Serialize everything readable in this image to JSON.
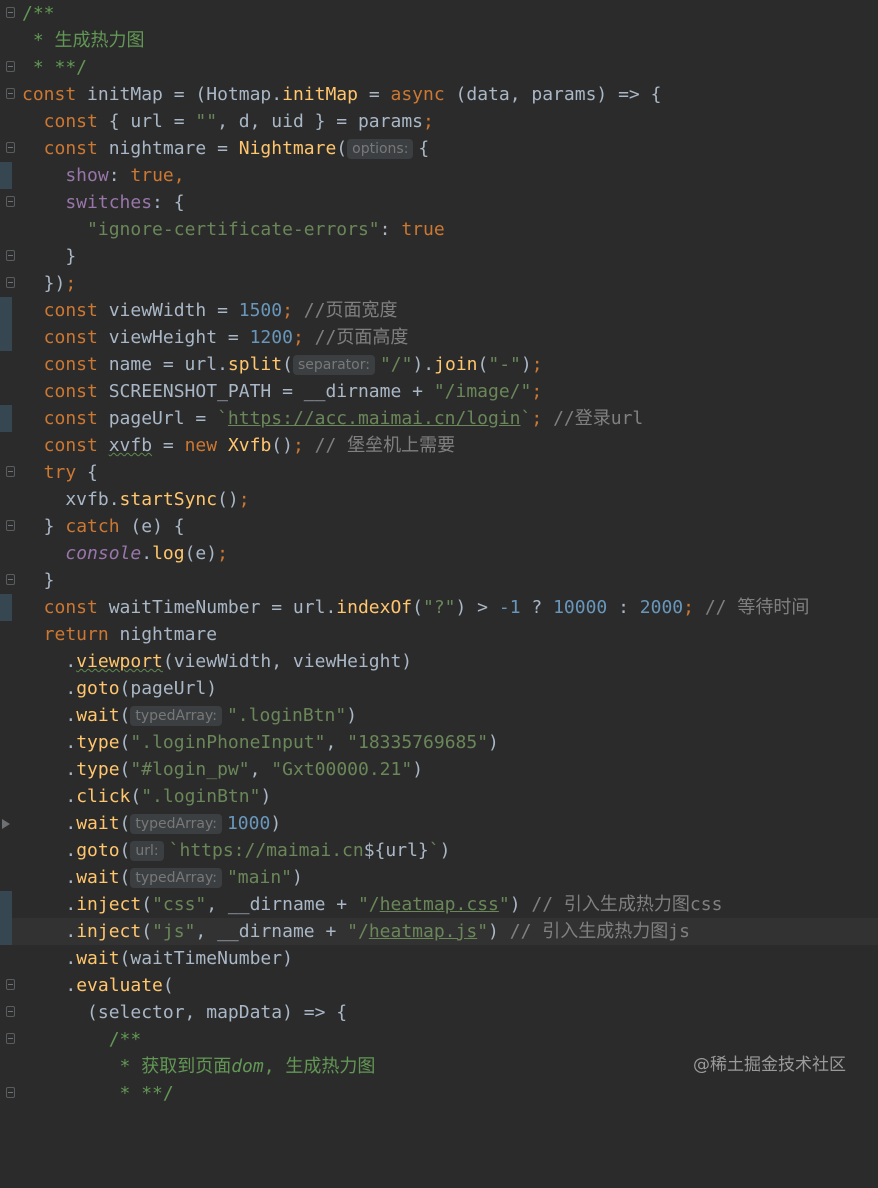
{
  "editor": {
    "watermark": "@稀土掘金技术社区",
    "lines": {
      "l1": "/**",
      "l2": " * 生成热力图",
      "l3": " * **/",
      "l4a": "const ",
      "l4b": "initMap",
      "l4c": " = (",
      "l4d": "Hotmap",
      "l4e": ".",
      "l4f": "initMap",
      "l4g": " = ",
      "l4h": "async",
      "l4i": " (data, params) => {",
      "l5a": "  const ",
      "l5b": "{ url = ",
      "l5c": "\"\"",
      "l5d": ", d, uid } = params",
      "l5e": ";",
      "l6a": "  const ",
      "l6b": "nightmare = ",
      "l6c": "Nightmare",
      "l6d": "(",
      "l6hint": "options:",
      "l6e": "{",
      "l7a": "    show",
      "l7b": ": ",
      "l7c": "true",
      "l7d": ",",
      "l8a": "    switches",
      "l8b": ": {",
      "l9a": "      ",
      "l9b": "\"ignore-certificate-errors\"",
      "l9c": ": ",
      "l9d": "true",
      "l10": "    }",
      "l11a": "  })",
      "l11b": ";",
      "l12a": "  const ",
      "l12b": "viewWidth = ",
      "l12c": "1500",
      "l12d": "; ",
      "l12e": "//页面宽度",
      "l13a": "  const ",
      "l13b": "viewHeight = ",
      "l13c": "1200",
      "l13d": "; ",
      "l13e": "//页面高度",
      "l14a": "  const ",
      "l14b": "name = url.",
      "l14c": "split",
      "l14d": "(",
      "l14hint": "separator:",
      "l14e": "\"/\"",
      "l14f": ").",
      "l14g": "join",
      "l14h": "(",
      "l14i": "\"-\"",
      "l14j": ")",
      "l14k": ";",
      "l15a": "  const ",
      "l15b": "SCREENSHOT_PATH = __dirname + ",
      "l15c": "\"/image/\"",
      "l15d": ";",
      "l16a": "  const ",
      "l16b": "pageUrl = ",
      "l16c": "`",
      "l16d": "https://acc.maimai.cn/login",
      "l16e": "`",
      "l16f": "; ",
      "l16g": "//登录url",
      "l17a": "  const ",
      "l17b": "xvfb",
      "l17c": " = ",
      "l17d": "new ",
      "l17e": "Xvfb",
      "l17f": "()",
      "l17g": "; ",
      "l17h": "// 堡垒机上需要",
      "l18a": "  try ",
      "l18b": "{",
      "l19a": "    xvfb.",
      "l19b": "startSync",
      "l19c": "()",
      "l19d": ";",
      "l20a": "  } ",
      "l20b": "catch ",
      "l20c": "(e) {",
      "l21a": "    ",
      "l21b": "console",
      "l21c": ".",
      "l21d": "log",
      "l21e": "(e)",
      "l21f": ";",
      "l22": "  }",
      "l23a": "  const ",
      "l23b": "waitTimeNumber = url.",
      "l23c": "indexOf",
      "l23d": "(",
      "l23e": "\"?\"",
      "l23f": ") > ",
      "l23g": "-1",
      "l23h": " ? ",
      "l23i": "10000",
      "l23j": " : ",
      "l23k": "2000",
      "l23l": "; ",
      "l23m": "// 等待时间",
      "l24a": "  return ",
      "l24b": "nightmare",
      "l25a": "    .",
      "l25b": "viewport",
      "l25c": "(viewWidth, viewHeight)",
      "l26a": "    .",
      "l26b": "goto",
      "l26c": "(pageUrl)",
      "l27a": "    .",
      "l27b": "wait",
      "l27c": "(",
      "l27hint": "typedArray:",
      "l27d": "\".loginBtn\"",
      "l27e": ")",
      "l28a": "    .",
      "l28b": "type",
      "l28c": "(",
      "l28d": "\".loginPhoneInput\"",
      "l28e": ", ",
      "l28f": "\"18335769685\"",
      "l28g": ")",
      "l29a": "    .",
      "l29b": "type",
      "l29c": "(",
      "l29d": "\"#login_pw\"",
      "l29e": ", ",
      "l29f": "\"Gxt00000.21\"",
      "l29g": ")",
      "l30a": "    .",
      "l30b": "click",
      "l30c": "(",
      "l30d": "\".loginBtn\"",
      "l30e": ")",
      "l31a": "    .",
      "l31b": "wait",
      "l31c": "(",
      "l31hint": "typedArray:",
      "l31d": "1000",
      "l31e": ")",
      "l32a": "    .",
      "l32b": "goto",
      "l32c": "(",
      "l32hint": "url:",
      "l32d": "`https://maimai.cn",
      "l32e": "${url}",
      "l32f": "`",
      "l32g": ")",
      "l33a": "    .",
      "l33b": "wait",
      "l33c": "(",
      "l33hint": "typedArray:",
      "l33d": "\"main\"",
      "l33e": ")",
      "l34a": "    .",
      "l34b": "inject",
      "l34c": "(",
      "l34d": "\"css\"",
      "l34e": ", __dirname + ",
      "l34f": "\"/",
      "l34g": "heatmap.css",
      "l34h": "\"",
      "l34i": ") ",
      "l34j": "// 引入生成热力图css",
      "l35a": "    .",
      "l35b": "inject",
      "l35c": "(",
      "l35d": "\"js\"",
      "l35e": ", __dirname + ",
      "l35f": "\"/",
      "l35g": "heatmap.js",
      "l35h": "\"",
      "l35i": ") ",
      "l35j": "// 引入生成热力图js",
      "l36a": "    .",
      "l36b": "wait",
      "l36c": "(waitTimeNumber)",
      "l37a": "    .",
      "l37b": "evaluate",
      "l37c": "(",
      "l38": "      (selector, mapData) => {",
      "l39": "        /**",
      "l40a": "         * 获取到页面",
      "l40b": "dom",
      "l40c": ", 生成热力图",
      "l41": "         * **/"
    }
  },
  "colors": {
    "background": "#2b2b2b",
    "keyword": "#cc7832",
    "string": "#6a8759",
    "number": "#6897bb",
    "function": "#ffc66d",
    "property": "#9876aa",
    "comment": "#808080",
    "doc_comment": "#629755",
    "text": "#a9b7c6"
  }
}
